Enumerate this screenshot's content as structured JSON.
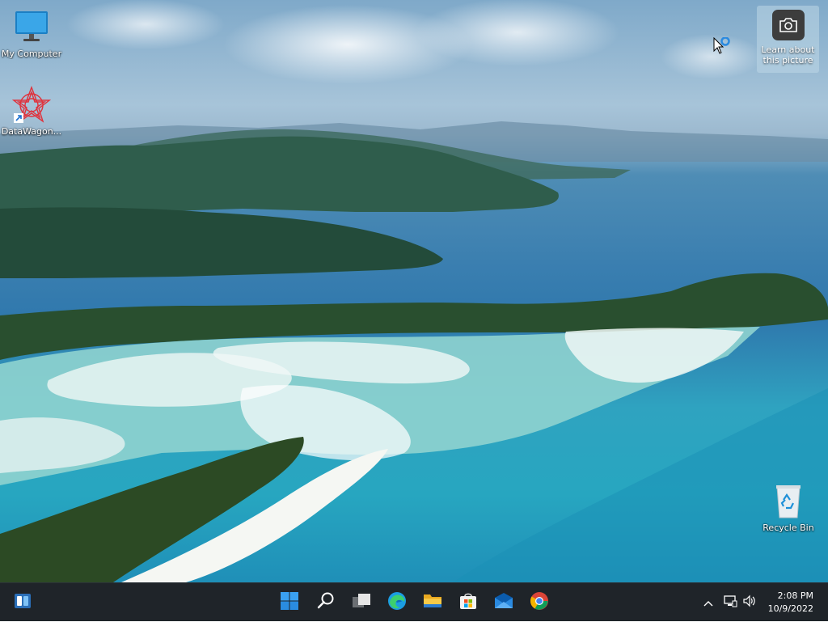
{
  "desktop": {
    "icons": [
      {
        "label": "My Computer",
        "icon": "monitor-icon"
      },
      {
        "label": "DataWagon...",
        "icon": "datawagon-icon"
      },
      {
        "label": "Recycle Bin",
        "icon": "recycle-bin-icon"
      }
    ],
    "spotlight": {
      "label": "Learn about this picture",
      "icon": "camera-icon"
    }
  },
  "taskbar": {
    "items": [
      {
        "name": "widgets",
        "icon": "widgets-icon"
      },
      {
        "name": "start",
        "icon": "windows-start-icon"
      },
      {
        "name": "search",
        "icon": "search-icon"
      },
      {
        "name": "task-view",
        "icon": "task-view-icon"
      },
      {
        "name": "edge",
        "icon": "edge-icon"
      },
      {
        "name": "file-explorer",
        "icon": "folder-icon"
      },
      {
        "name": "store",
        "icon": "store-icon"
      },
      {
        "name": "mail",
        "icon": "mail-icon"
      },
      {
        "name": "chrome",
        "icon": "chrome-icon"
      }
    ],
    "tray": {
      "icons": [
        "chevron-up-icon",
        "network-icon",
        "volume-icon"
      ]
    },
    "clock": {
      "time": "2:08 PM",
      "date": "10/9/2022"
    }
  },
  "colors": {
    "taskbar_bg": "#1f2429",
    "accent": "#0078d4"
  }
}
